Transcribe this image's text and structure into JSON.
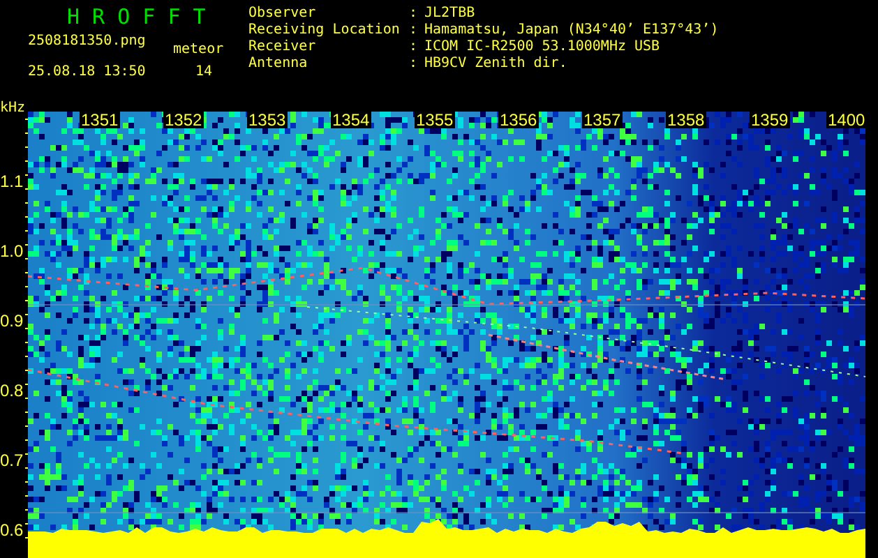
{
  "app_title": "H R O F F T",
  "file_name": "2508181350.png",
  "datetime": "25.08.18 13:50",
  "meteor_label": "meteor",
  "meteor_count": "14",
  "station_info": [
    {
      "label": "Observer",
      "separator": ":",
      "value": "JL2TBB"
    },
    {
      "label": "Receiving Location",
      "separator": ":",
      "value": "Hamamatsu, Japan (N34°40’ E137°43’)"
    },
    {
      "label": "Receiver",
      "separator": ":",
      "value": "ICOM IC-R2500 53.1000MHz USB"
    },
    {
      "label": "Antenna",
      "separator": ":",
      "value": "HB9CV Zenith dir."
    }
  ],
  "spectrogram": {
    "y_unit": "kHz",
    "time_labels": [
      "1351",
      "1352",
      "1353",
      "1354",
      "1355",
      "1356",
      "1357",
      "1358",
      "1359",
      "1400"
    ],
    "frequency_labels": [
      "1.1",
      "1.0",
      "0.9",
      "0.8",
      "0.7",
      "0.6"
    ]
  }
}
